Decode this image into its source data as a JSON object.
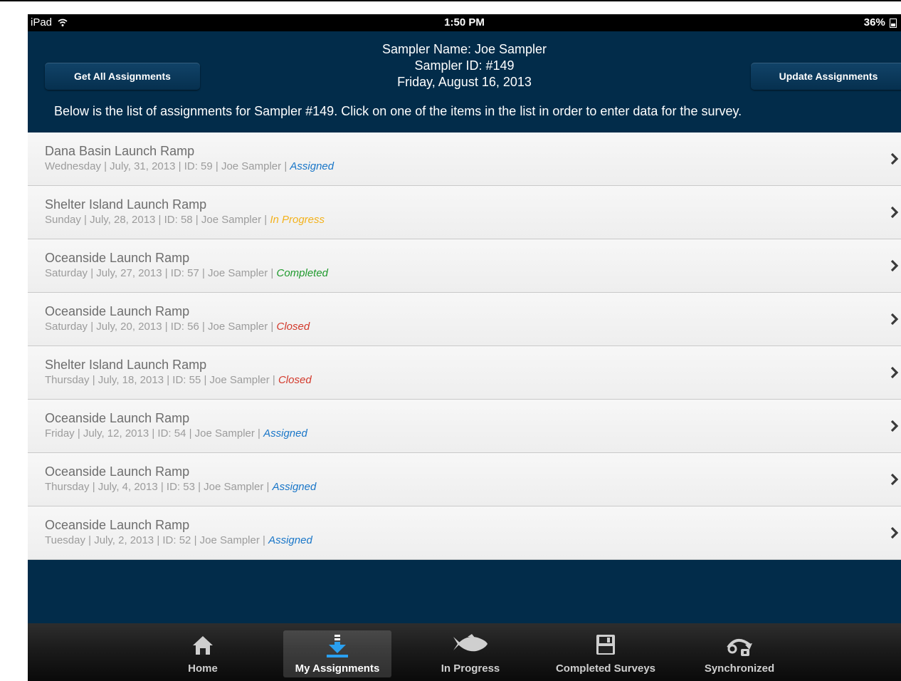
{
  "status_bar": {
    "device": "iPad",
    "time": "1:50 PM",
    "battery": "36%"
  },
  "header": {
    "sampler_name": "Sampler Name: Joe Sampler",
    "sampler_id": "Sampler ID: #149",
    "date": "Friday, August 16, 2013",
    "get_all_label": "Get All Assignments",
    "update_label": "Update Assignments",
    "instructions": "Below is the list of assignments for Sampler #149. Click on one of the items in the list in order to enter data for the survey."
  },
  "assignments": [
    {
      "title": "Dana Basin Launch Ramp",
      "details": "Wednesday | July, 31, 2013 | ID: 59 | Joe Sampler | ",
      "status": "Assigned",
      "status_color": "#1976c8"
    },
    {
      "title": "Shelter Island Launch Ramp",
      "details": "Sunday | July, 28, 2013 | ID: 58 | Joe Sampler | ",
      "status": "In Progress",
      "status_color": "#f3b21c"
    },
    {
      "title": "Oceanside Launch Ramp",
      "details": "Saturday | July, 27, 2013 | ID: 57 | Joe Sampler | ",
      "status": "Completed",
      "status_color": "#1f9a2d"
    },
    {
      "title": "Oceanside Launch Ramp",
      "details": "Saturday | July, 20, 2013 | ID: 56 | Joe Sampler | ",
      "status": "Closed",
      "status_color": "#d33a2c"
    },
    {
      "title": "Shelter Island Launch Ramp",
      "details": "Thursday | July, 18, 2013 | ID: 55 | Joe Sampler | ",
      "status": "Closed",
      "status_color": "#d33a2c"
    },
    {
      "title": "Oceanside Launch Ramp",
      "details": "Friday | July, 12, 2013 | ID: 54 | Joe Sampler | ",
      "status": "Assigned",
      "status_color": "#1976c8"
    },
    {
      "title": "Oceanside Launch Ramp",
      "details": "Thursday | July, 4, 2013 | ID: 53 | Joe Sampler | ",
      "status": "Assigned",
      "status_color": "#1976c8"
    },
    {
      "title": "Oceanside Launch Ramp",
      "details": "Tuesday | July, 2, 2013 | ID: 52 | Joe Sampler | ",
      "status": "Assigned",
      "status_color": "#1976c8"
    }
  ],
  "tabs": [
    {
      "label": "Home",
      "icon": "home-icon"
    },
    {
      "label": "My Assignments",
      "icon": "download-icon",
      "active": true
    },
    {
      "label": "In Progress",
      "icon": "fish-icon"
    },
    {
      "label": "Completed Surveys",
      "icon": "save-disk-icon"
    },
    {
      "label": "Synchronized",
      "icon": "sync-lock-icon"
    }
  ],
  "colors": {
    "header_bg": "#022c4a",
    "accent_blue": "#1976c8"
  }
}
